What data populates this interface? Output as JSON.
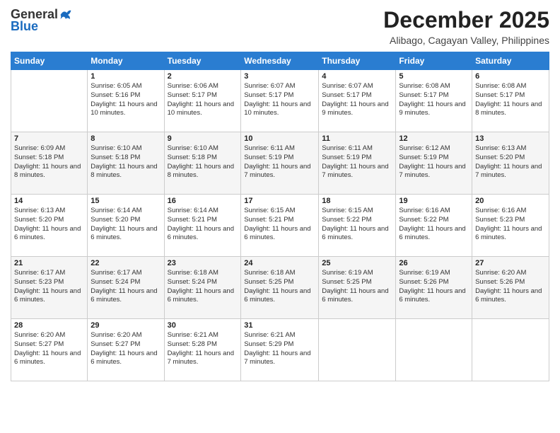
{
  "header": {
    "logo_line1": "General",
    "logo_line2": "Blue",
    "month": "December 2025",
    "location": "Alibago, Cagayan Valley, Philippines"
  },
  "weekdays": [
    "Sunday",
    "Monday",
    "Tuesday",
    "Wednesday",
    "Thursday",
    "Friday",
    "Saturday"
  ],
  "weeks": [
    [
      {
        "day": "",
        "info": ""
      },
      {
        "day": "1",
        "info": "Sunrise: 6:05 AM\nSunset: 5:16 PM\nDaylight: 11 hours and 10 minutes."
      },
      {
        "day": "2",
        "info": "Sunrise: 6:06 AM\nSunset: 5:17 PM\nDaylight: 11 hours and 10 minutes."
      },
      {
        "day": "3",
        "info": "Sunrise: 6:07 AM\nSunset: 5:17 PM\nDaylight: 11 hours and 10 minutes."
      },
      {
        "day": "4",
        "info": "Sunrise: 6:07 AM\nSunset: 5:17 PM\nDaylight: 11 hours and 9 minutes."
      },
      {
        "day": "5",
        "info": "Sunrise: 6:08 AM\nSunset: 5:17 PM\nDaylight: 11 hours and 9 minutes."
      },
      {
        "day": "6",
        "info": "Sunrise: 6:08 AM\nSunset: 5:17 PM\nDaylight: 11 hours and 8 minutes."
      }
    ],
    [
      {
        "day": "7",
        "info": "Sunrise: 6:09 AM\nSunset: 5:18 PM\nDaylight: 11 hours and 8 minutes."
      },
      {
        "day": "8",
        "info": "Sunrise: 6:10 AM\nSunset: 5:18 PM\nDaylight: 11 hours and 8 minutes."
      },
      {
        "day": "9",
        "info": "Sunrise: 6:10 AM\nSunset: 5:18 PM\nDaylight: 11 hours and 8 minutes."
      },
      {
        "day": "10",
        "info": "Sunrise: 6:11 AM\nSunset: 5:19 PM\nDaylight: 11 hours and 7 minutes."
      },
      {
        "day": "11",
        "info": "Sunrise: 6:11 AM\nSunset: 5:19 PM\nDaylight: 11 hours and 7 minutes."
      },
      {
        "day": "12",
        "info": "Sunrise: 6:12 AM\nSunset: 5:19 PM\nDaylight: 11 hours and 7 minutes."
      },
      {
        "day": "13",
        "info": "Sunrise: 6:13 AM\nSunset: 5:20 PM\nDaylight: 11 hours and 7 minutes."
      }
    ],
    [
      {
        "day": "14",
        "info": "Sunrise: 6:13 AM\nSunset: 5:20 PM\nDaylight: 11 hours and 6 minutes."
      },
      {
        "day": "15",
        "info": "Sunrise: 6:14 AM\nSunset: 5:20 PM\nDaylight: 11 hours and 6 minutes."
      },
      {
        "day": "16",
        "info": "Sunrise: 6:14 AM\nSunset: 5:21 PM\nDaylight: 11 hours and 6 minutes."
      },
      {
        "day": "17",
        "info": "Sunrise: 6:15 AM\nSunset: 5:21 PM\nDaylight: 11 hours and 6 minutes."
      },
      {
        "day": "18",
        "info": "Sunrise: 6:15 AM\nSunset: 5:22 PM\nDaylight: 11 hours and 6 minutes."
      },
      {
        "day": "19",
        "info": "Sunrise: 6:16 AM\nSunset: 5:22 PM\nDaylight: 11 hours and 6 minutes."
      },
      {
        "day": "20",
        "info": "Sunrise: 6:16 AM\nSunset: 5:23 PM\nDaylight: 11 hours and 6 minutes."
      }
    ],
    [
      {
        "day": "21",
        "info": "Sunrise: 6:17 AM\nSunset: 5:23 PM\nDaylight: 11 hours and 6 minutes."
      },
      {
        "day": "22",
        "info": "Sunrise: 6:17 AM\nSunset: 5:24 PM\nDaylight: 11 hours and 6 minutes."
      },
      {
        "day": "23",
        "info": "Sunrise: 6:18 AM\nSunset: 5:24 PM\nDaylight: 11 hours and 6 minutes."
      },
      {
        "day": "24",
        "info": "Sunrise: 6:18 AM\nSunset: 5:25 PM\nDaylight: 11 hours and 6 minutes."
      },
      {
        "day": "25",
        "info": "Sunrise: 6:19 AM\nSunset: 5:25 PM\nDaylight: 11 hours and 6 minutes."
      },
      {
        "day": "26",
        "info": "Sunrise: 6:19 AM\nSunset: 5:26 PM\nDaylight: 11 hours and 6 minutes."
      },
      {
        "day": "27",
        "info": "Sunrise: 6:20 AM\nSunset: 5:26 PM\nDaylight: 11 hours and 6 minutes."
      }
    ],
    [
      {
        "day": "28",
        "info": "Sunrise: 6:20 AM\nSunset: 5:27 PM\nDaylight: 11 hours and 6 minutes."
      },
      {
        "day": "29",
        "info": "Sunrise: 6:20 AM\nSunset: 5:27 PM\nDaylight: 11 hours and 6 minutes."
      },
      {
        "day": "30",
        "info": "Sunrise: 6:21 AM\nSunset: 5:28 PM\nDaylight: 11 hours and 7 minutes."
      },
      {
        "day": "31",
        "info": "Sunrise: 6:21 AM\nSunset: 5:29 PM\nDaylight: 11 hours and 7 minutes."
      },
      {
        "day": "",
        "info": ""
      },
      {
        "day": "",
        "info": ""
      },
      {
        "day": "",
        "info": ""
      }
    ]
  ]
}
